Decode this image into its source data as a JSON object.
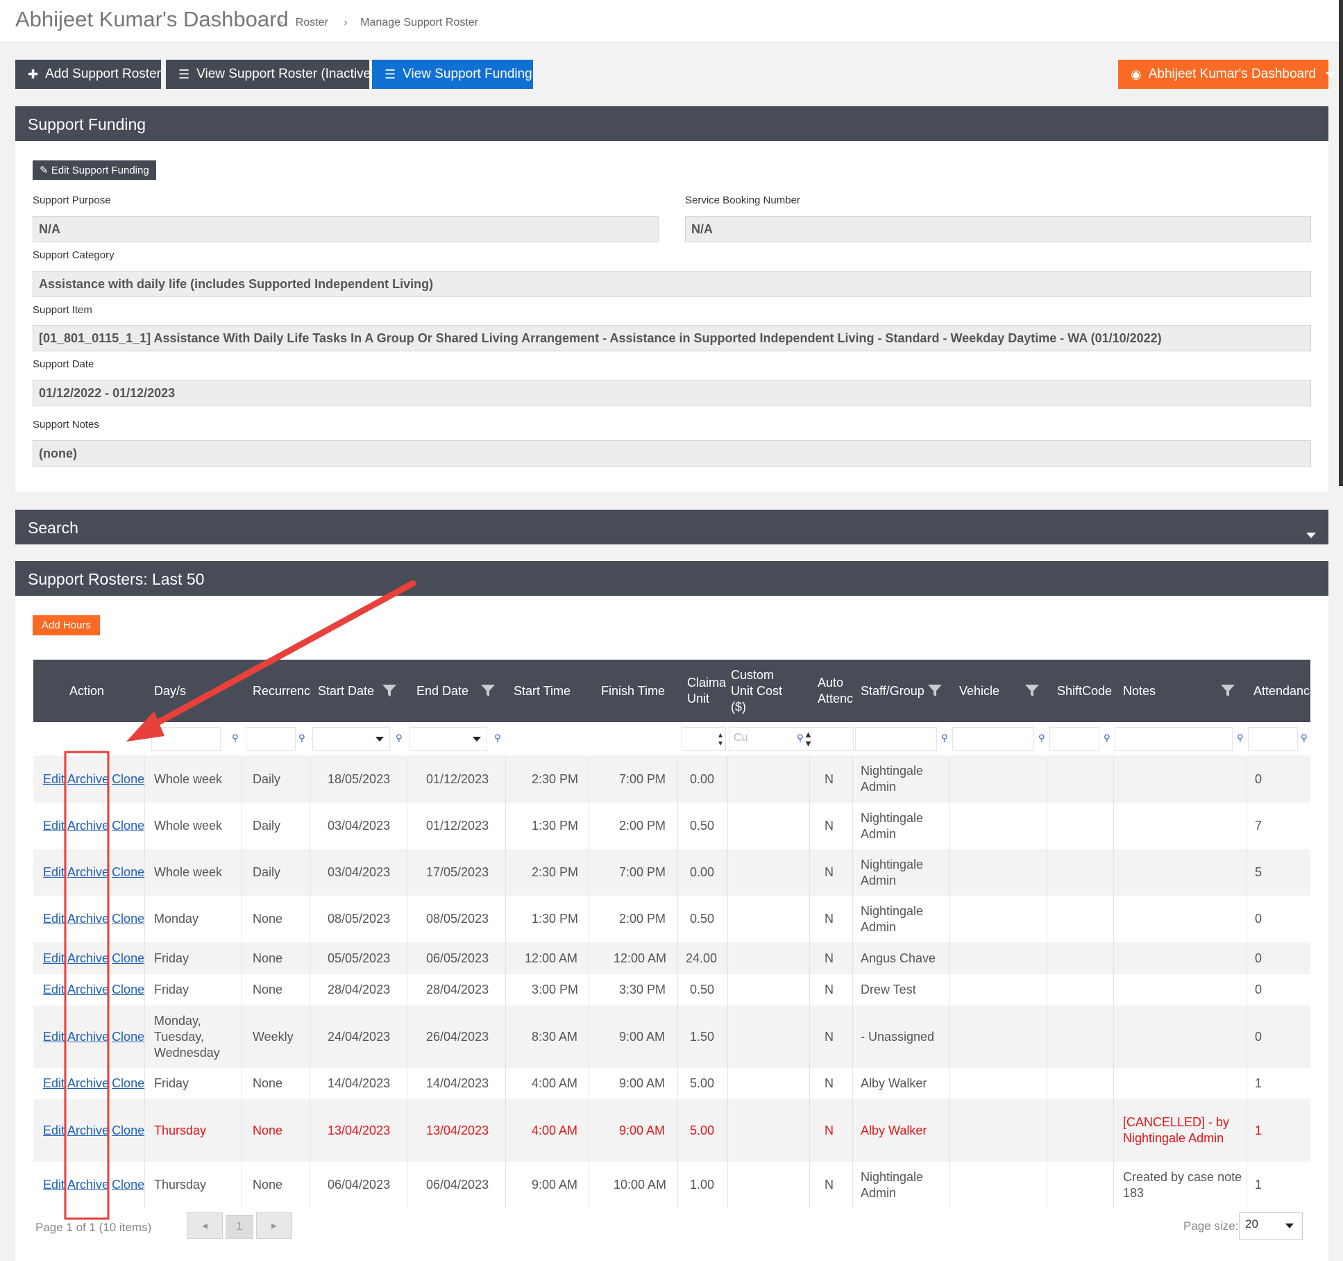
{
  "header": {
    "title": "Abhijeet Kumar's Dashboard",
    "breadcrumbs": [
      "Roster",
      "Manage Support Roster"
    ]
  },
  "toolbar": {
    "add_roster": "Add Support Roster",
    "view_inactive": "View Support Roster (Inactive)",
    "view_funding": "View Support Funding",
    "dashboard_menu": "Abhijeet Kumar's Dashboard"
  },
  "funding": {
    "title": "Support Funding",
    "edit_button": "Edit Support Funding",
    "purpose_label": "Support Purpose",
    "purpose_value": "N/A",
    "booking_label": "Service Booking Number",
    "booking_value": "N/A",
    "category_label": "Support Category",
    "category_value": "Assistance with daily life (includes Supported Independent Living)",
    "item_label": "Support Item",
    "item_value": "[01_801_0115_1_1] Assistance With Daily Life Tasks In A Group Or Shared Living Arrangement - Assistance in Supported Independent Living - Standard - Weekday Daytime - WA (01/10/2022)",
    "date_label": "Support Date",
    "date_value": "01/12/2022 - 01/12/2023",
    "notes_label": "Support Notes",
    "notes_value": "(none)"
  },
  "search": {
    "title": "Search"
  },
  "rosters": {
    "title": "Support Rosters: Last 50",
    "add_hours": "Add Hours",
    "columns": {
      "action": "Action",
      "days": "Day/s",
      "recurrence": "Recurrence",
      "start_date": "Start Date",
      "end_date": "End Date",
      "start_time": "Start Time",
      "finish_time": "Finish Time",
      "claim_unit_1": "Claima",
      "claim_unit_2": "Unit",
      "custom_cost_1": "Custom",
      "custom_cost_2": "Unit Cost",
      "custom_cost_3": "($)",
      "auto_attend_1": "Auto",
      "auto_attend_2": "Attenc",
      "staff": "Staff/Group",
      "vehicle": "Vehicle",
      "shiftcode": "ShiftCode",
      "notes": "Notes",
      "attendance": "Attendanc"
    },
    "custom_cost_placeholder": "Cu",
    "action_links": {
      "edit": "Edit",
      "archive": "Archive",
      "clone": "Clone"
    },
    "rows": [
      {
        "days": [
          "Whole week"
        ],
        "recurrence": "Daily",
        "start_date": "18/05/2023",
        "end_date": "01/12/2023",
        "start_time": "2:30 PM",
        "finish_time": "7:00 PM",
        "claim": "0.00",
        "auto": "N",
        "staff": [
          "Nightingale",
          "Admin"
        ],
        "notes": [],
        "attendance": "0",
        "cancelled": false
      },
      {
        "days": [
          "Whole week"
        ],
        "recurrence": "Daily",
        "start_date": "03/04/2023",
        "end_date": "01/12/2023",
        "start_time": "1:30 PM",
        "finish_time": "2:00 PM",
        "claim": "0.50",
        "auto": "N",
        "staff": [
          "Nightingale",
          "Admin"
        ],
        "notes": [],
        "attendance": "7",
        "cancelled": false
      },
      {
        "days": [
          "Whole week"
        ],
        "recurrence": "Daily",
        "start_date": "03/04/2023",
        "end_date": "17/05/2023",
        "start_time": "2:30 PM",
        "finish_time": "7:00 PM",
        "claim": "0.00",
        "auto": "N",
        "staff": [
          "Nightingale",
          "Admin"
        ],
        "notes": [],
        "attendance": "5",
        "cancelled": false
      },
      {
        "days": [
          "Monday"
        ],
        "recurrence": "None",
        "start_date": "08/05/2023",
        "end_date": "08/05/2023",
        "start_time": "1:30 PM",
        "finish_time": "2:00 PM",
        "claim": "0.50",
        "auto": "N",
        "staff": [
          "Nightingale",
          "Admin"
        ],
        "notes": [],
        "attendance": "0",
        "cancelled": false
      },
      {
        "days": [
          "Friday"
        ],
        "recurrence": "None",
        "start_date": "05/05/2023",
        "end_date": "06/05/2023",
        "start_time": "12:00 AM",
        "finish_time": "12:00 AM",
        "claim": "24.00",
        "auto": "N",
        "staff": [
          "Angus Chave"
        ],
        "notes": [],
        "attendance": "0",
        "cancelled": false
      },
      {
        "days": [
          "Friday"
        ],
        "recurrence": "None",
        "start_date": "28/04/2023",
        "end_date": "28/04/2023",
        "start_time": "3:00 PM",
        "finish_time": "3:30 PM",
        "claim": "0.50",
        "auto": "N",
        "staff": [
          "Drew Test"
        ],
        "notes": [],
        "attendance": "0",
        "cancelled": false
      },
      {
        "days": [
          "Monday,",
          "Tuesday,",
          "Wednesday"
        ],
        "recurrence": "Weekly",
        "start_date": "24/04/2023",
        "end_date": "26/04/2023",
        "start_time": "8:30 AM",
        "finish_time": "9:00 AM",
        "claim": "1.50",
        "auto": "N",
        "staff": [
          "- Unassigned"
        ],
        "notes": [],
        "attendance": "0",
        "cancelled": false
      },
      {
        "days": [
          "Friday"
        ],
        "recurrence": "None",
        "start_date": "14/04/2023",
        "end_date": "14/04/2023",
        "start_time": "4:00 AM",
        "finish_time": "9:00 AM",
        "claim": "5.00",
        "auto": "N",
        "staff": [
          "Alby Walker"
        ],
        "notes": [],
        "attendance": "1",
        "cancelled": false
      },
      {
        "days": [
          "Thursday"
        ],
        "recurrence": "None",
        "start_date": "13/04/2023",
        "end_date": "13/04/2023",
        "start_time": "4:00 AM",
        "finish_time": "9:00 AM",
        "claim": "5.00",
        "auto": "N",
        "staff": [
          "Alby Walker"
        ],
        "notes": [
          "[CANCELLED] - by",
          "Nightingale Admin"
        ],
        "attendance": "1",
        "cancelled": true
      },
      {
        "days": [
          "Thursday"
        ],
        "recurrence": "None",
        "start_date": "06/04/2023",
        "end_date": "06/04/2023",
        "start_time": "9:00 AM",
        "finish_time": "10:00 AM",
        "claim": "1.00",
        "auto": "N",
        "staff": [
          "Nightingale",
          "Admin"
        ],
        "notes": [
          "Created by case note",
          "183"
        ],
        "attendance": "1",
        "cancelled": false
      }
    ],
    "pager": {
      "info": "Page 1 of 1 (10 items)",
      "current_page": "1",
      "page_size_label": "Page size:",
      "page_size": "20"
    }
  },
  "colors": {
    "panel_header": "#474c56",
    "accent_blue": "#1170d4",
    "accent_orange": "#f96b24",
    "cancelled_red": "#e3151a",
    "annotation_red": "#e8403a"
  },
  "icons": [
    "plus-icon",
    "list-icon",
    "dashboard-icon",
    "pencil-icon",
    "filter-icon",
    "caret-down-icon",
    "chevron-left-icon",
    "chevron-right-icon"
  ]
}
